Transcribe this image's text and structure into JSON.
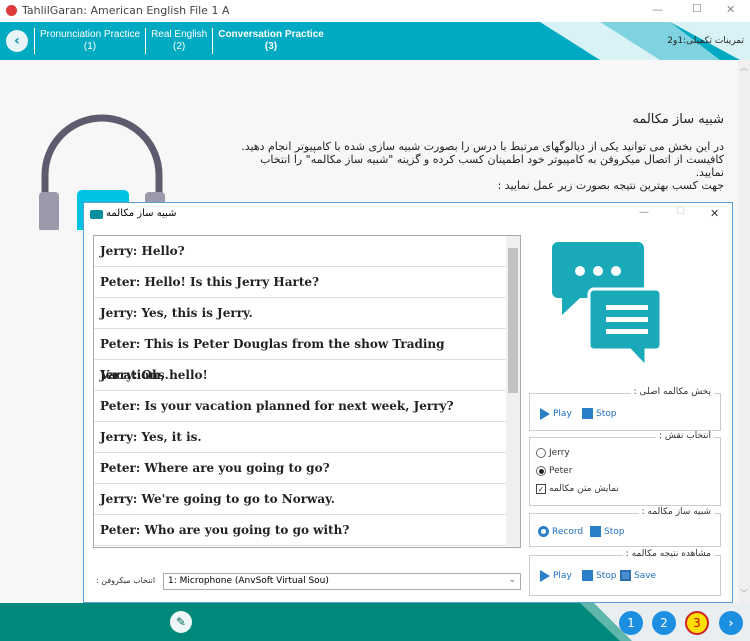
{
  "window": {
    "title": "TahlilGaran: American English File 1 A",
    "min": "—",
    "max": "☐",
    "close": "✕"
  },
  "header": {
    "tabs": [
      {
        "label": "Pronunciation Practice",
        "num": "(1)"
      },
      {
        "label": "Real English",
        "num": "(2)"
      },
      {
        "label": "Conversation Practice",
        "num": "(3)"
      }
    ],
    "right_label": "تمرینات تکمیلی:1و2"
  },
  "intro": {
    "title": "شبیه ساز مکالمه",
    "lines": [
      "در این بخش می توانید یکی از دیالوگهای مرتبط با درس را بصورت شبیه سازی شده با کامپیوتر انجام دهید.",
      "کافیست از اتصال میکروفن به کامپیوتر خود اطمینان کسب کرده و گزینه \"شبیه ساز مکالمه\" را انتخاب",
      "نمایید.",
      "جهت کسب بهترین نتیجه بصورت زیر عمل نمایید :"
    ]
  },
  "dialog": {
    "title": "شبیه ساز مکالمه",
    "lines": [
      "Jerry: Hello?",
      "Peter: Hello! Is this Jerry Harte?",
      "Jerry: Yes, this is Jerry.",
      "Peter: This is Peter Douglas from the show Trading Vacations.",
      "Jerry: Oh, hello!",
      "Peter: Is your vacation planned for next week, Jerry?",
      "Jerry: Yes, it is.",
      "Peter: Where are you going to go?",
      "Jerry: We're going to go to Norway.",
      "Peter: Who are you going to go with?"
    ],
    "mic_label": "انتخاب میکروفن :",
    "mic_value": "1: Microphone (AnvSoft Virtual Sou)",
    "original": {
      "label": "پخش مکالمه اصلی :",
      "play": "Play",
      "stop": "Stop"
    },
    "role": {
      "label": "انتخاب نقش :",
      "options": [
        "Jerry",
        "Peter"
      ],
      "selected": "Peter",
      "show_text": "نمایش متن مکالمه",
      "show_text_checked": true
    },
    "simulate": {
      "label": "شبیه ساز مکالمه :",
      "record": "Record",
      "stop": "Stop"
    },
    "result": {
      "label": "مشاهده نتیجه مکالمه :",
      "play": "Play",
      "stop": "Stop",
      "save": "Save"
    }
  },
  "pager": {
    "pages": [
      "1",
      "2",
      "3"
    ],
    "current": "3"
  },
  "colors": {
    "header": "#00aac2",
    "footer": "#00897b",
    "accent": "#2a7fc9",
    "current_page": "#ffe000"
  }
}
